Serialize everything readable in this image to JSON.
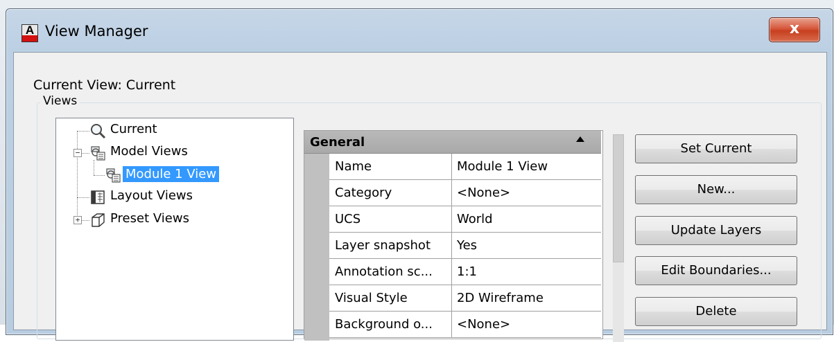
{
  "window": {
    "title": "View Manager",
    "close_label": "x",
    "icon": "autocad-app-icon"
  },
  "current_view": "Current View: Current",
  "views_group_label": "Views",
  "tree": {
    "items": [
      {
        "label": "Current",
        "icon": "magnifier-icon"
      },
      {
        "label": "Model Views",
        "icon": "model-views-icon",
        "expanded": true
      },
      {
        "label": "Module 1 View",
        "icon": "model-view-icon",
        "selected": true
      },
      {
        "label": "Layout Views",
        "icon": "layout-views-icon"
      },
      {
        "label": "Preset Views",
        "icon": "cube-icon",
        "expanded": false
      }
    ]
  },
  "properties": {
    "section": "General",
    "rows": [
      {
        "key": "Name",
        "value": "Module 1 View"
      },
      {
        "key": "Category",
        "value": "<None>"
      },
      {
        "key": "UCS",
        "value": "World"
      },
      {
        "key": "Layer snapshot",
        "value": "Yes"
      },
      {
        "key": "Annotation sc...",
        "value": "1:1"
      },
      {
        "key": "Visual Style",
        "value": "2D Wireframe"
      },
      {
        "key": "Background o...",
        "value": "<None>"
      }
    ]
  },
  "buttons": {
    "set_current": "Set Current",
    "new": "New...",
    "update_layers": "Update Layers",
    "edit_boundaries": "Edit Boundaries...",
    "delete": "Delete"
  },
  "colors": {
    "selection": "#3399ff",
    "title_bar": "#bcd0e4",
    "close_button": "#c7401f"
  }
}
